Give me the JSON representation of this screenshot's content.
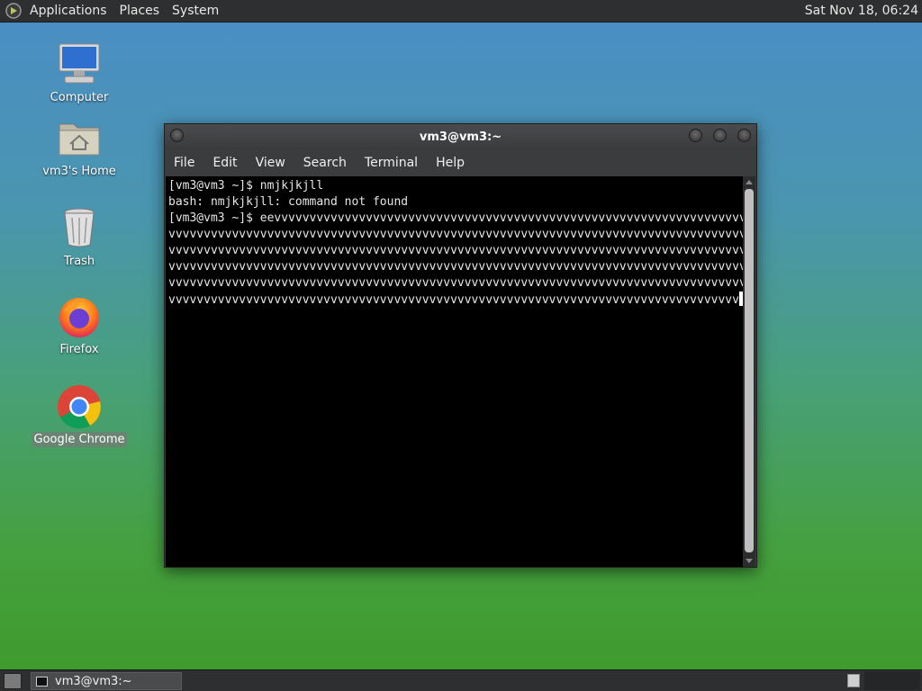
{
  "top_panel": {
    "menus": [
      "Applications",
      "Places",
      "System"
    ],
    "clock": "Sat Nov 18, 06:24"
  },
  "desktop_icons": [
    {
      "label": "Computer",
      "icon": "computer-icon"
    },
    {
      "label": "vm3's Home",
      "icon": "home-folder-icon"
    },
    {
      "label": "Trash",
      "icon": "trash-icon"
    },
    {
      "label": "Firefox",
      "icon": "firefox-icon"
    },
    {
      "label": "Google Chrome",
      "icon": "chrome-icon",
      "selected": true
    }
  ],
  "terminal_window": {
    "title": "vm3@vm3:~",
    "menus": [
      "File",
      "Edit",
      "View",
      "Search",
      "Terminal",
      "Help"
    ],
    "lines": [
      "[vm3@vm3 ~]$ nmjkjkjll",
      "bash: nmjkjkjll: command not found",
      "[vm3@vm3 ~]$ eevvvvvvvvvvvvvvvvvvvvvvvvvvvvvvvvvvvvvvvvvvvvvvvvvvvvvvvvvvvvvvvvvvvvvv",
      "vvvvvvvvvvvvvvvvvvvvvvvvvvvvvvvvvvvvvvvvvvvvvvvvvvvvvvvvvvvvvvvvvvvvvvvvvvvvvvvvvvvvvvvv",
      "vvvvvvvvvvvvvvvvvvvvvvvvvvvvvvvvvvvvvvvvvvvvvvvvvvvvvvvvvvvvvvvvvvvvvvvvvvvvvvvvvvvvvvvv",
      "vvvvvvvvvvvvvvvvvvvvvvvvvvvvvvvvvvvvvvvvvvvvvvvvvvvvvvvvvvvvvvvvvvvvvvvvvvvvvvvvvvvvvvvv",
      "vvvvvvvvvvvvvvvvvvvvvvvvvvvvvvvvvvvvvvvvvvvvvvvvvvvvvvvvvvvvvvvvvvvvvvvvvvvvvvvvvvvvvvvv",
      "vvvvvvvvvvvvvvvvvvvvvvvvvvvvvvvvvvvvvvvvvvvvvvvvvvvvvvvvvvvvvvvvvvvvvvvvvvvvvvvvv"
    ]
  },
  "bottom_panel": {
    "task_label": "vm3@vm3:~"
  },
  "colors": {
    "panel": "#2e2f30",
    "terminal_bg": "#000000",
    "terminal_fg": "#e6e6e6",
    "window_frame": "#3b3c3e"
  }
}
